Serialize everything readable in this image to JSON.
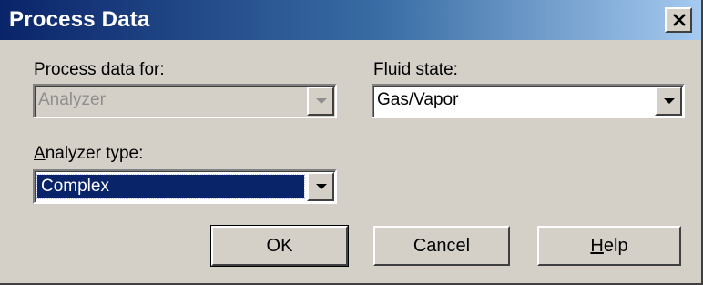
{
  "window": {
    "title": "Process Data",
    "close_icon": "close-icon"
  },
  "process_data_for": {
    "label_mnemonic": "P",
    "label_rest": "rocess data for:",
    "value": "Analyzer",
    "enabled": false
  },
  "fluid_state": {
    "label_mnemonic": "F",
    "label_rest": "luid state:",
    "value": "Gas/Vapor"
  },
  "analyzer_type": {
    "label_mnemonic": "A",
    "label_rest": "nalyzer type:",
    "value": "Complex",
    "focused": true
  },
  "buttons": {
    "ok": "OK",
    "cancel": "Cancel",
    "help_mnemonic": "H",
    "help_rest": "elp"
  },
  "colors": {
    "face": "#d4d0c8",
    "title_start": "#0a246a",
    "title_end": "#a6caf0",
    "selection": "#0a246a"
  }
}
